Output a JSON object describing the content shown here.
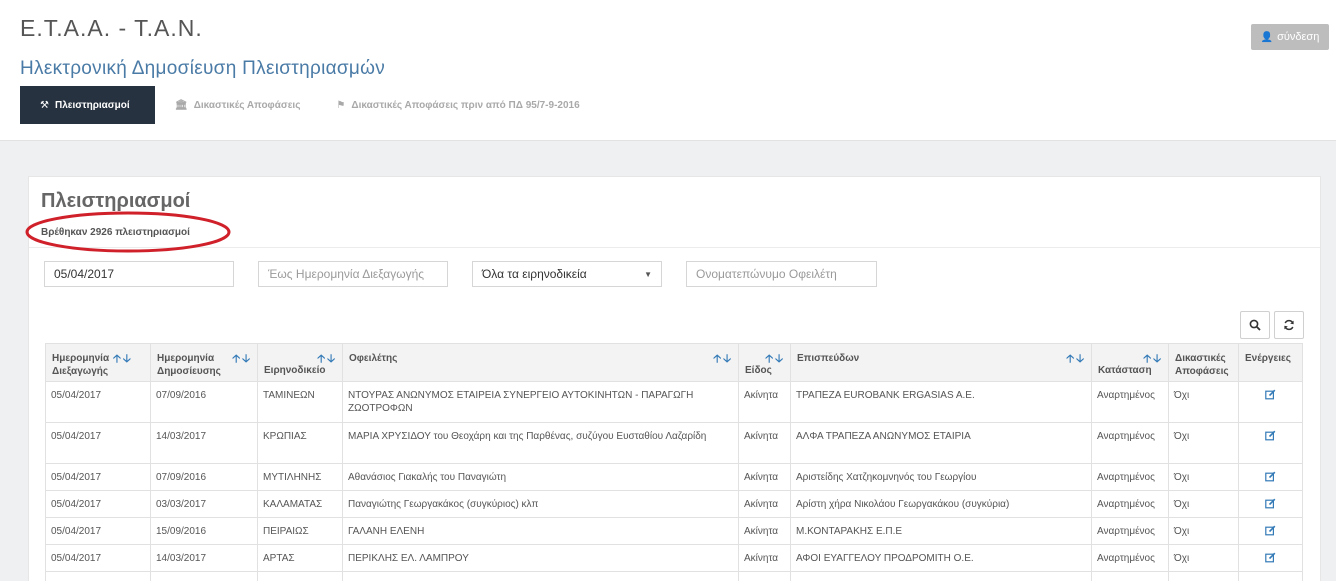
{
  "header": {
    "brand": "Ε.Τ.Α.Α. - Τ.Α.Ν.",
    "subtitle": "Ηλεκτρονική Δημοσίευση Πλειστηριασμών",
    "login_label": "σύνδεση"
  },
  "nav": [
    {
      "label": "Πλειστηριασμοί",
      "icon": "gavel-icon"
    },
    {
      "label": "Δικαστικές Αποφάσεις",
      "icon": "bank-icon"
    },
    {
      "label": "Δικαστικές Αποφάσεις πριν από ΠΔ 95/7-9-2016",
      "icon": "tag-icon"
    }
  ],
  "panel": {
    "title": "Πλειστηριασμοί",
    "count_text": "Βρέθηκαν 2926 πλειστηριασμοί"
  },
  "filters": {
    "from_date_value": "05/04/2017",
    "to_date_placeholder": "Έως Ημερομηνία Διεξαγωγής",
    "court_selected": "Όλα τα ειρηνοδικεία",
    "debtor_placeholder": "Ονοματεπώνυμο Οφειλέτη"
  },
  "columns": [
    {
      "l1": "Ημερομηνία",
      "l2": "Διεξαγωγής"
    },
    {
      "l1": "Ημερομηνία",
      "l2": "Δημοσίευσης"
    },
    {
      "l1": "",
      "l2": "Ειρηνοδικείο"
    },
    {
      "l1": "Οφειλέτης",
      "l2": ""
    },
    {
      "l1": "",
      "l2": "Είδος"
    },
    {
      "l1": "Επισπεύδων",
      "l2": ""
    },
    {
      "l1": "",
      "l2": "Κατάσταση"
    },
    {
      "l1": "Δικαστικές",
      "l2": "Αποφάσεις"
    },
    {
      "l1": "Ενέργειες",
      "l2": ""
    }
  ],
  "rows": [
    [
      "05/04/2017",
      "07/09/2016",
      "ΤΑΜΙΝΕΩΝ",
      "ΝΤΟΥΡΑΣ ΑΝΩΝΥΜΟΣ ΕΤΑΙΡΕΙΑ ΣΥΝΕΡΓΕΙΟ ΑΥΤΟΚΙΝΗΤΩΝ - ΠΑΡΑΓΩΓΗ ΖΩΟΤΡΟΦΩΝ",
      "Ακίνητα",
      "ΤΡΑΠΕΖΑ EUROBANK ERGASIAS A.E.",
      "Αναρτημένος",
      "Όχι"
    ],
    [
      "05/04/2017",
      "14/03/2017",
      "ΚΡΩΠΙΑΣ",
      "ΜΑΡΙΑ ΧΡΥΣΙΔΟΥ του Θεοχάρη και της Παρθένας, συζύγου Ευσταθίου Λαζαρίδη",
      "Ακίνητα",
      "ΑΛΦΑ ΤΡΑΠΕΖΑ ΑΝΩΝΥΜΟΣ ΕΤΑΙΡΙΑ",
      "Αναρτημένος",
      "Όχι"
    ],
    [
      "05/04/2017",
      "07/09/2016",
      "ΜΥΤΙΛΗΝΗΣ",
      "Αθανάσιος Γιακαλής του Παναγιώτη",
      "Ακίνητα",
      "Αριστείδης Χατζηκομνηνός του Γεωργίου",
      "Αναρτημένος",
      "Όχι"
    ],
    [
      "05/04/2017",
      "03/03/2017",
      "ΚΑΛΑΜΑΤΑΣ",
      "Παναγιώτης Γεωργακάκος (συγκύριος) κλπ",
      "Ακίνητα",
      "Αρίστη χήρα Νικολάου Γεωργακάκου (συγκύρια)",
      "Αναρτημένος",
      "Όχι"
    ],
    [
      "05/04/2017",
      "15/09/2016",
      "ΠΕΙΡΑΙΩΣ",
      "ΓΑΛΑΝΗ ΕΛΕΝΗ",
      "Ακίνητα",
      "Μ.ΚΟΝΤΑΡΑΚΗΣ Ε.Π.Ε",
      "Αναρτημένος",
      "Όχι"
    ],
    [
      "05/04/2017",
      "14/03/2017",
      "ΑΡΤΑΣ",
      "ΠΕΡΙΚΛΗΣ ΕΛ. ΛΑΜΠΡΟΥ",
      "Ακίνητα",
      "ΑΦΟΙ ΕΥΑΓΓΕΛΟΥ ΠΡΟΔΡΟΜΙΤΗ Ο.Ε.",
      "Αναρτημένος",
      "Όχι"
    ],
    [
      "",
      "",
      "",
      "",
      "",
      "",
      "",
      ""
    ]
  ],
  "colors": {
    "nav_active": "#26323f",
    "link": "#337ab7",
    "annotation": "#d0202a"
  }
}
